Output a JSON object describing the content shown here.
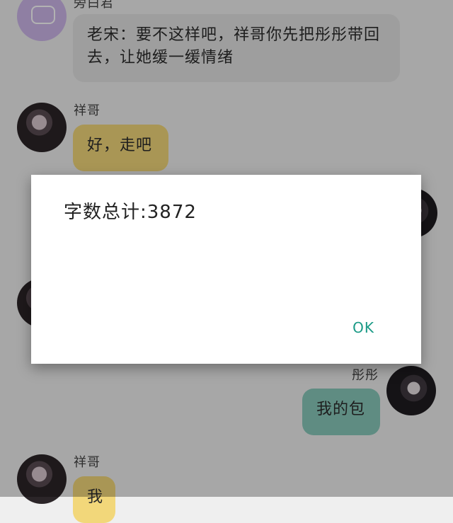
{
  "chat": {
    "messages": [
      {
        "sender": "旁白君",
        "text": "老宋：要不这样吧，祥哥你先把彤彤带回去，让她缓一缓情绪"
      },
      {
        "sender": "祥哥",
        "text": "好，走吧"
      },
      {
        "sender": "彤彤",
        "text": "我的包"
      },
      {
        "sender": "祥哥",
        "text": "我"
      }
    ]
  },
  "dialog": {
    "message": "字数总计:3872",
    "ok_label": "OK"
  },
  "colors": {
    "accent": "#1a9a86",
    "bubble_grey": "#e2e2e2",
    "bubble_yellow": "#f2d77a",
    "bubble_teal": "#89c9bb"
  }
}
